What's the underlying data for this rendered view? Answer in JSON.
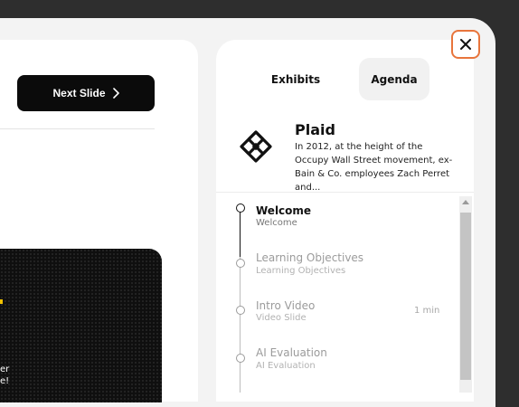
{
  "toolbar": {
    "next_slide_label": "Next Slide"
  },
  "video": {
    "caption": "er\ne!"
  },
  "tabs": [
    {
      "label": "Exhibits",
      "selected": false
    },
    {
      "label": "Agenda",
      "selected": true
    }
  ],
  "company": {
    "name": "Plaid",
    "description": "In 2012, at the height of the Occupy Wall Street movement, ex-Bain & Co. employees Zach Perret and..."
  },
  "agenda": [
    {
      "title": "Welcome",
      "subtitle": "Welcome",
      "duration": "",
      "active": true
    },
    {
      "title": "Learning Objectives",
      "subtitle": "Learning Objectives",
      "duration": "",
      "active": false
    },
    {
      "title": "Intro Video",
      "subtitle": "Video Slide",
      "duration": "1 min",
      "active": false
    },
    {
      "title": "AI Evaluation",
      "subtitle": "AI Evaluation",
      "duration": "",
      "active": false
    }
  ],
  "icons": {
    "close": "close-icon",
    "next": "chevron-right-icon",
    "logo": "plaid-logo",
    "scroll_up": "arrow-up-icon"
  },
  "colors": {
    "accent_border": "#e8753c",
    "primary_button": "#0b0b0b",
    "video_accent": "#f2c200"
  }
}
